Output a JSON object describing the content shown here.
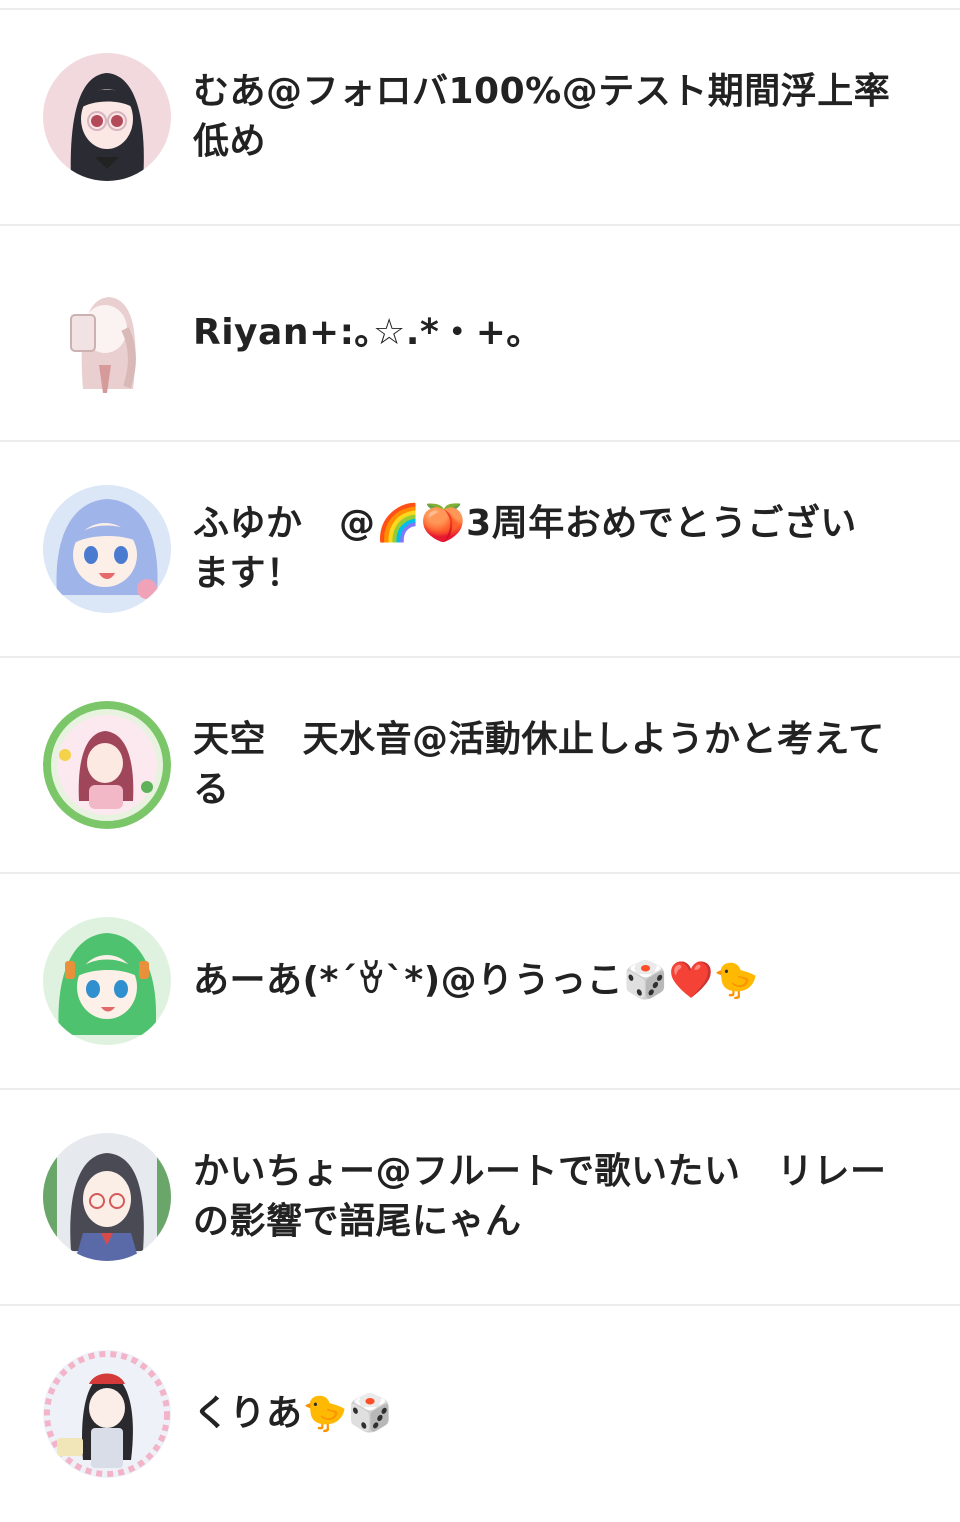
{
  "users": [
    {
      "name": "むあ@フォロバ100%@テスト期間浮上率低め",
      "avatar_icon": "user-avatar-icon"
    },
    {
      "name": "Riyan+:｡☆.*・+｡",
      "avatar_icon": "user-avatar-icon"
    },
    {
      "name": "ふゆか　@🌈🍑3周年おめでとうございます！",
      "avatar_icon": "user-avatar-icon"
    },
    {
      "name": "天空　天水音@活動休止しようかと考えてる",
      "avatar_icon": "user-avatar-icon"
    },
    {
      "name": "あーあ(*´ꈊ`*)@りうっこ🎲❤️🐤",
      "avatar_icon": "user-avatar-icon"
    },
    {
      "name": "かいちょー@フルートで歌いたい　リレーの影響で語尾にゃん",
      "avatar_icon": "user-avatar-icon"
    },
    {
      "name": "くりあ🐤🎲",
      "avatar_icon": "user-avatar-icon"
    }
  ],
  "avatar_colors": [
    "#f2d9de",
    "#f4ecec",
    "#dbe6f7",
    "#e7f3df",
    "#dff2e0",
    "#e6e9ee",
    "#eef2f8"
  ]
}
